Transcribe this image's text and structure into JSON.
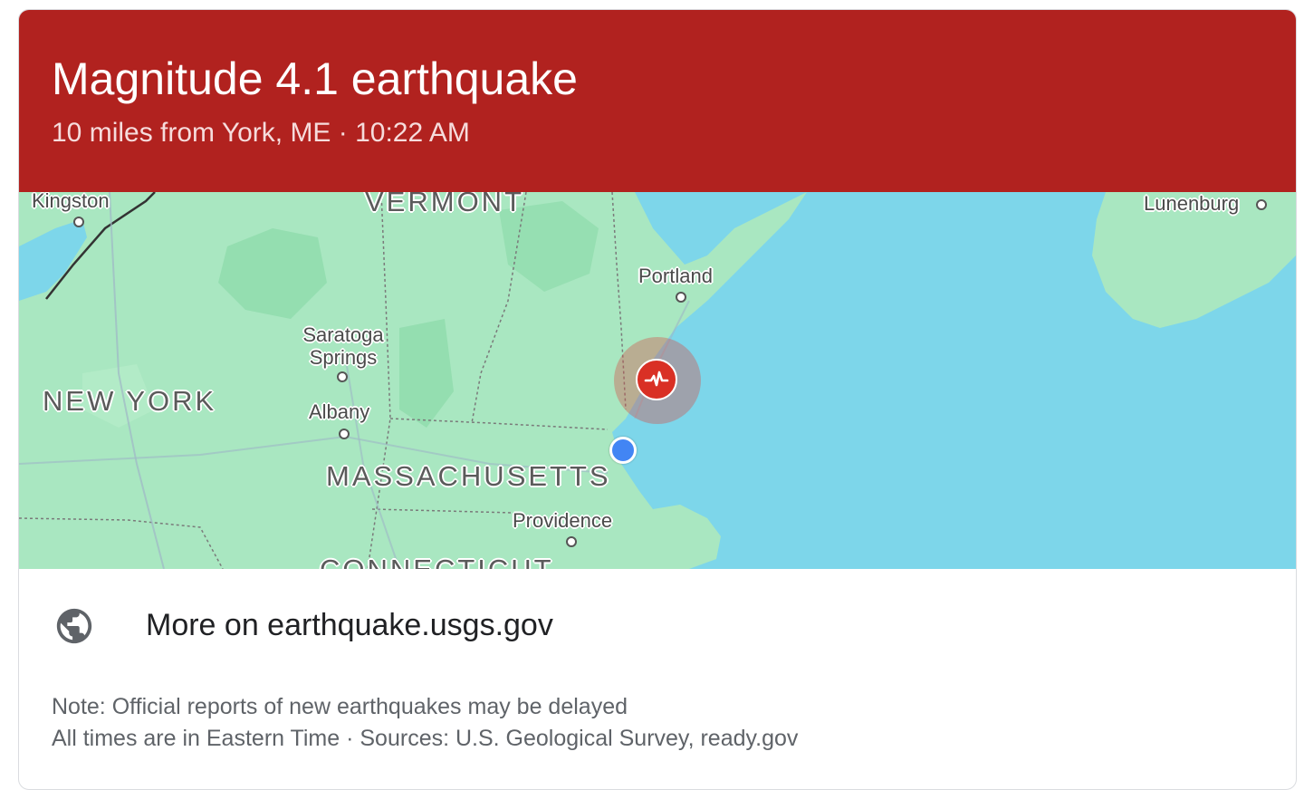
{
  "header": {
    "title": "Magnitude 4.1 earthquake",
    "subtitle": "10 miles from York, ME · 10:22 AM",
    "background_color": "#b1221f"
  },
  "map": {
    "water_color": "#7dd6ea",
    "land_color": "#a9e7c1",
    "quake_marker_color": "#d93025",
    "user_location_color": "#4285f4",
    "cities": [
      {
        "name": "Kingston"
      },
      {
        "name": "Portland"
      },
      {
        "name": "Saratoga Springs"
      },
      {
        "name": "Albany"
      },
      {
        "name": "Providence"
      },
      {
        "name": "Lunenburg"
      }
    ],
    "states": [
      {
        "name": "VERMONT"
      },
      {
        "name": "NEW YORK"
      },
      {
        "name": "MASSACHUSETTS"
      },
      {
        "name": "CONNECTICUT"
      }
    ],
    "quake_icon": "seismograph-icon",
    "user_icon": "current-location-dot"
  },
  "more": {
    "icon": "globe-icon",
    "label": "More on earthquake.usgs.gov"
  },
  "notes": {
    "line1": "Note: Official reports of new earthquakes may be delayed",
    "line2": "All times are in Eastern Time · Sources: U.S. Geological Survey, ready.gov"
  }
}
